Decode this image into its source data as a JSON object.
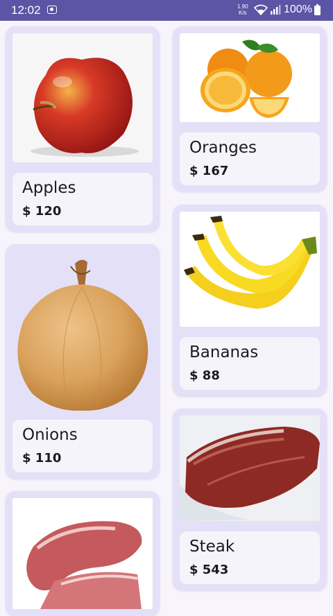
{
  "status_bar": {
    "time": "12:02",
    "net_speed_value": "1.90",
    "net_speed_unit": "K/s",
    "battery": "100%"
  },
  "products": [
    {
      "name": "Apples",
      "price": "$ 120",
      "image": "apple-image"
    },
    {
      "name": "Oranges",
      "price": "$ 167",
      "image": "oranges-image"
    },
    {
      "name": "Onions",
      "price": "$ 110",
      "image": "onion-image"
    },
    {
      "name": "Bananas",
      "price": "$ 88",
      "image": "bananas-image"
    },
    {
      "name": "Steak",
      "price": "$ 543",
      "image": "steak-image"
    },
    {
      "name": "",
      "price": "",
      "image": "pork-chop-image"
    }
  ],
  "colors": {
    "status_bar": "#5c54a4",
    "card_background": "#e4e0f8",
    "info_panel": "#f6f4fb",
    "page_background": "#f7f5fb"
  }
}
